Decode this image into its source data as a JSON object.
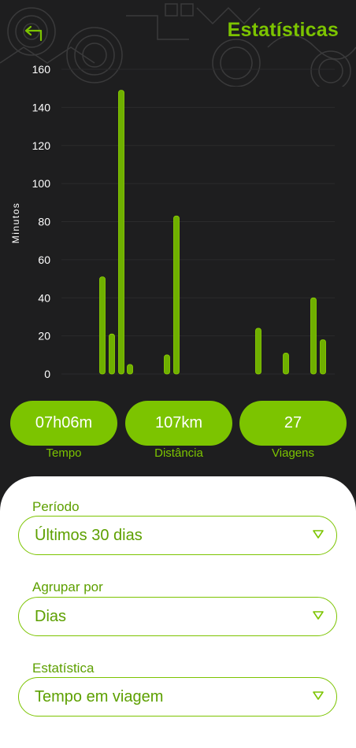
{
  "header": {
    "title": "Estatísticas",
    "back_icon": "back-arrow-icon"
  },
  "chart_data": {
    "type": "bar",
    "ylabel": "Minutos",
    "ylim": [
      0,
      160
    ],
    "yticks": [
      0,
      20,
      40,
      60,
      80,
      100,
      120,
      140,
      160
    ],
    "grid": true,
    "bar_color": "#6fb000",
    "series": [
      {
        "values": [
          51,
          21,
          149,
          5,
          10,
          83,
          24,
          11,
          40,
          18
        ]
      }
    ],
    "bar_positions_note": "bars grouped on a daily axis; days without trips show no bar"
  },
  "summary": [
    {
      "value": "07h06m",
      "label": "Tempo"
    },
    {
      "value": "107km",
      "label": "Distância"
    },
    {
      "value": "27",
      "label": "Viagens"
    }
  ],
  "filters": [
    {
      "label": "Período",
      "value": "Últimos 30 dias"
    },
    {
      "label": "Agrupar por",
      "value": "Dias"
    },
    {
      "label": "Estatística",
      "value": "Tempo em viagem"
    }
  ],
  "colors": {
    "accent": "#7cc400",
    "background": "#1e1e1f",
    "sheet": "#ffffff"
  }
}
